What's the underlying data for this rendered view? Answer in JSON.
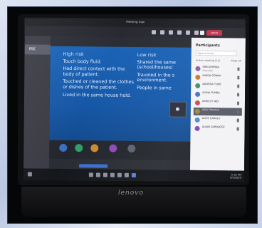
{
  "window": {
    "title": "Meeting now"
  },
  "toolbar": {
    "leave_label": "Leave"
  },
  "left_rail": {
    "tab_label": "MK"
  },
  "slide": {
    "left_heading": "High risk",
    "left_items": [
      "Touch body fluid.",
      "Had direct contact with the body of patient.",
      "Touched or cleaned the clothes or dishes of the patient.",
      "Lived in the same house hold."
    ],
    "right_heading": "Low risk",
    "right_items": [
      "Shared the same (school/houses/",
      "Traveled in the s environment.",
      "People in same"
    ]
  },
  "participants_panel": {
    "title": "Participants",
    "search_placeholder": "Type a name",
    "section_label": "In this meeting (12)",
    "mute_all_label": "Mute all",
    "people": [
      {
        "name": "ERIN JOHNNA",
        "sub": "Organizer",
        "color": "#8e5ca8"
      },
      {
        "name": "KAREN GONNA",
        "sub": "",
        "color": "#c9772e"
      },
      {
        "name": "AGNESIA TUKO",
        "sub": "",
        "color": "#3c8e6a"
      },
      {
        "name": "AUDIA PUMBA",
        "sub": "",
        "color": "#4a6fc2"
      },
      {
        "name": "ASHELEY AJO",
        "sub": "",
        "color": "#c2504a"
      },
      {
        "name": "ASIA Florence",
        "sub": "",
        "color": "#a08a3c"
      },
      {
        "name": "ALICE LUMALA",
        "sub": "",
        "color": "#4a8ec2"
      },
      {
        "name": "ALVAN GARBAGGE",
        "sub": "",
        "color": "#7a4ac2"
      }
    ]
  },
  "strip_avatars": [
    "#3c6fc2",
    "#2f9e6b",
    "#c98a2e",
    "#8c4ab8",
    "#5b6270"
  ],
  "taskbar": {
    "time": "2:18 PM",
    "date": "9/3/2020"
  },
  "brand": {
    "laptop": "lenovo"
  }
}
